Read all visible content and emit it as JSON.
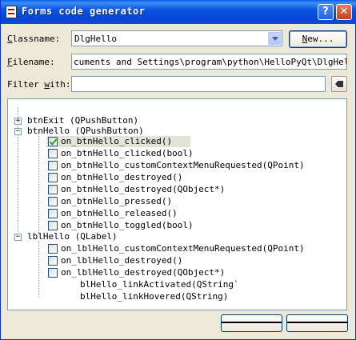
{
  "window": {
    "title": "Forms code generator",
    "help_glyph": "?",
    "close_glyph": "✕"
  },
  "classname": {
    "label_u": "C",
    "label_rest": "lassname:",
    "value": "DlgHello",
    "new_button_u": "N",
    "new_button_rest": "ew..."
  },
  "filename": {
    "label_u": "F",
    "label_rest": "ilename:",
    "value": "cuments and Settings\\program\\python\\HelloPyQt\\DlgHello.py"
  },
  "filter": {
    "label_pre": "Filter ",
    "label_u": "w",
    "label_rest": "ith:",
    "value": ""
  },
  "tree": {
    "items": [
      {
        "label": "btnExit (QPushButton)",
        "kind": "group",
        "expanded": false
      },
      {
        "label": "btnHello (QPushButton)",
        "kind": "group",
        "expanded": true
      },
      {
        "label": "on_btnHello_clicked()",
        "kind": "slot",
        "checked": true,
        "selected": true
      },
      {
        "label": "on_btnHello_clicked(bool)",
        "kind": "slot",
        "checked": false
      },
      {
        "label": "on_btnHello_customContextMenuRequested(QPoint)",
        "kind": "slot",
        "checked": false
      },
      {
        "label": "on_btnHello_destroyed()",
        "kind": "slot",
        "checked": false
      },
      {
        "label": "on_btnHello_destroyed(QObject*)",
        "kind": "slot",
        "checked": false
      },
      {
        "label": "on_btnHello_pressed()",
        "kind": "slot",
        "checked": false
      },
      {
        "label": "on_btnHello_released()",
        "kind": "slot",
        "checked": false
      },
      {
        "label": "on_btnHello_toggled(bool)",
        "kind": "slot",
        "checked": false
      },
      {
        "label": "lblHello (QLabel)",
        "kind": "group",
        "expanded": true
      },
      {
        "label": "on_lblHello_customContextMenuRequested(QPoint)",
        "kind": "slot",
        "checked": false
      },
      {
        "label": "on_lblHello_destroyed()",
        "kind": "slot",
        "checked": false
      },
      {
        "label": "on_lblHello_destroyed(QObject*)",
        "kind": "slot",
        "checked": false
      },
      {
        "label": "blHello_linkActivated(QString`",
        "kind": "slot-partial"
      },
      {
        "label": "blHello_linkHovered(QString)",
        "kind": "slot-partial"
      }
    ]
  },
  "buttons": {
    "ok": "",
    "cancel": ""
  }
}
